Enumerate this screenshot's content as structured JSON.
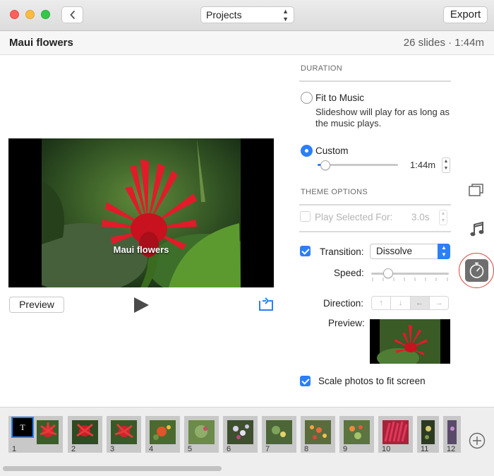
{
  "titlebar": {
    "projects_label": "Projects",
    "export_label": "Export"
  },
  "header": {
    "title": "Maui flowers",
    "info": "26 slides · 1:44m"
  },
  "preview": {
    "caption": "Maui flowers",
    "preview_label": "Preview"
  },
  "duration": {
    "heading": "DURATION",
    "fit_label": "Fit to Music",
    "fit_desc": "Slideshow will play for as long as the music plays.",
    "custom_label": "Custom",
    "custom_value": "1:44m",
    "selected": "custom"
  },
  "theme": {
    "heading": "THEME OPTIONS",
    "play_selected_label": "Play Selected For:",
    "play_selected_value": "3.0s",
    "transition_label": "Transition:",
    "transition_value": "Dissolve",
    "speed_label": "Speed:",
    "direction_label": "Direction:",
    "preview_label": "Preview:",
    "scale_label": "Scale photos to fit screen"
  },
  "filmstrip": {
    "title_slide": "T",
    "numbers": [
      "1",
      "2",
      "3",
      "4",
      "5",
      "6",
      "7",
      "8",
      "9",
      "10",
      "11",
      "12"
    ]
  },
  "colors": {
    "accent": "#2c7ff5",
    "highlight_ring": "#e0433a"
  }
}
